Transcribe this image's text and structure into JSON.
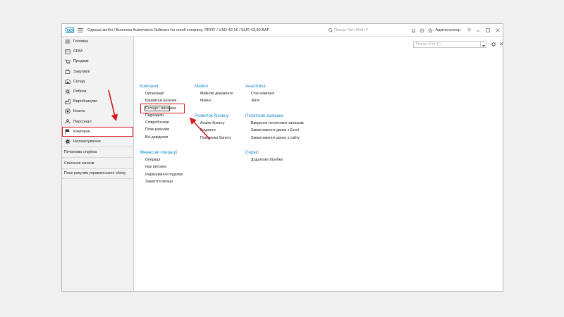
{
  "window": {
    "title": "Одеські меблі / Business Automation Software for small company. PROF / USD 42,16 / EUR 43,50 BAF",
    "search_placeholder": "Пошук Ctrl+Shift+F",
    "user": "Адміністратор"
  },
  "sidebar": {
    "items": [
      {
        "label": "Головне",
        "icon": "home-icon"
      },
      {
        "label": "CRM",
        "icon": "crm-icon"
      },
      {
        "label": "Продажі",
        "icon": "sales-icon"
      },
      {
        "label": "Закупівлі",
        "icon": "purchases-icon"
      },
      {
        "label": "Склад",
        "icon": "warehouse-icon"
      },
      {
        "label": "Роботи",
        "icon": "works-icon"
      },
      {
        "label": "Виробництво",
        "icon": "production-icon"
      },
      {
        "label": "Кошти",
        "icon": "money-icon"
      },
      {
        "label": "Персонал",
        "icon": "staff-icon"
      },
      {
        "label": "Компанія",
        "icon": "flag-icon"
      },
      {
        "label": "Налаштування",
        "icon": "gear-icon"
      }
    ],
    "links": [
      "Початкова сторінка",
      "Списання запасів",
      "План рахунків управлінського обліку"
    ]
  },
  "main": {
    "search_placeholder": "Пошук (Ctrl+F)",
    "sections": {
      "company": {
        "title": "Компанія",
        "links": [
          "Організації",
          "Банківські рахунки",
          "Склади і магазини",
          "Підрозділи",
          "Співробітники",
          "План рахунків",
          "Всі довідники"
        ]
      },
      "finance": {
        "title": "Фінансові операції",
        "links": [
          "Операції",
          "Інші витрати",
          "Нарахування податків",
          "Закриття місяця"
        ]
      },
      "property": {
        "title": "Майно",
        "links": [
          "Майнові документи",
          "Майно"
        ]
      },
      "business": {
        "title": "Розвиток бізнесу",
        "links": [
          "Аналіз бізнесу",
          "Бюджети",
          "Показники бізнесу"
        ]
      },
      "analytics": {
        "title": "Аналітика",
        "links": [
          "Стан компанії",
          "Звіти"
        ]
      },
      "initial": {
        "title": "Початкові залишки",
        "links": [
          "Введення початкових залишків",
          "Завантаження даних з Excel",
          "Завантаження даних з сайту"
        ]
      },
      "service": {
        "title": "Сервіс",
        "links": [
          "Додаткові обробки"
        ]
      }
    }
  },
  "colors": {
    "accent": "#1a8cc9",
    "highlight": "#d9161c"
  }
}
